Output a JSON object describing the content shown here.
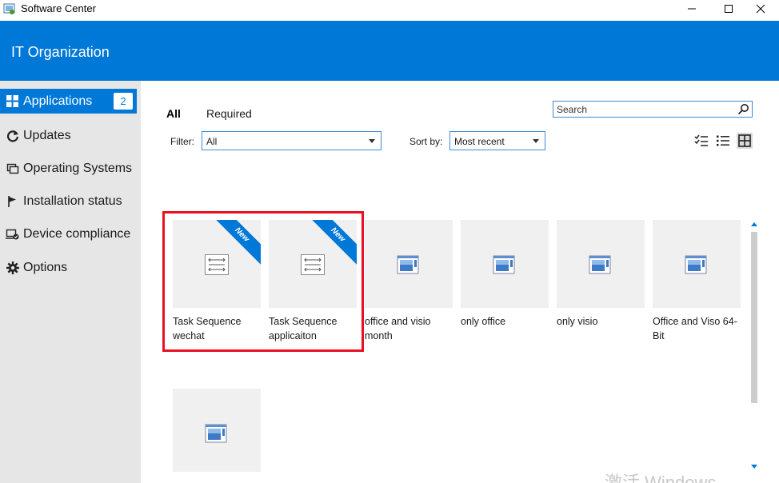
{
  "window": {
    "title": "Software Center",
    "icon": "software-center-icon",
    "controls": [
      "minimize-icon",
      "maximize-icon",
      "close-icon"
    ]
  },
  "header": {
    "org_name": "IT Organization",
    "color": "#0078d7"
  },
  "sidebar": {
    "items": [
      {
        "label": "Applications",
        "icon": "apps-grid-icon",
        "badge": "2",
        "active": true
      },
      {
        "label": "Updates",
        "icon": "refresh-icon"
      },
      {
        "label": "Operating Systems",
        "icon": "windows-stack-icon"
      },
      {
        "label": "Installation status",
        "icon": "flag-icon"
      },
      {
        "label": "Device compliance",
        "icon": "device-check-icon"
      },
      {
        "label": "Options",
        "icon": "gear-icon"
      }
    ]
  },
  "main": {
    "tabs": [
      {
        "label": "All",
        "active": true
      },
      {
        "label": "Required"
      }
    ],
    "search": {
      "placeholder": "Search"
    },
    "filter": {
      "label": "Filter:",
      "value": "All"
    },
    "sort": {
      "label": "Sort by:",
      "value": "Most recent"
    },
    "view_modes": [
      "checklist-view-icon",
      "list-view-icon",
      "tile-view-icon"
    ],
    "active_view": "tile-view-icon",
    "apps": [
      {
        "name": "Task Sequence wechat",
        "icon": "task-sequence-icon",
        "badge": "New"
      },
      {
        "name": "Task Sequence applicaiton",
        "icon": "task-sequence-icon",
        "badge": "New"
      },
      {
        "name": "office and visio month",
        "icon": "application-window-icon"
      },
      {
        "name": "only office",
        "icon": "application-window-icon"
      },
      {
        "name": "only visio",
        "icon": "application-window-icon"
      },
      {
        "name": "Office and Viso 64-Bit",
        "icon": "application-window-icon"
      },
      {
        "name": "",
        "icon": "application-window-icon"
      }
    ]
  },
  "watermark": "激活 Windows",
  "highlight_color": "#e81123"
}
